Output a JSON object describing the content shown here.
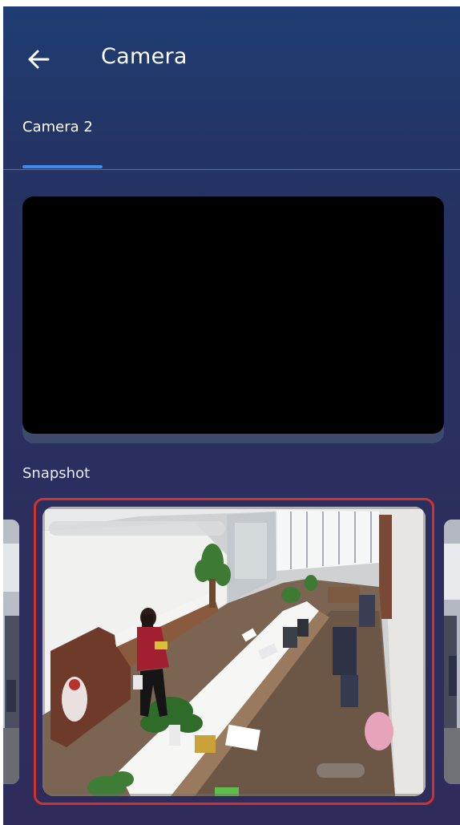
{
  "header": {
    "title": "Camera",
    "back_icon": "arrow-left-icon"
  },
  "tabs": [
    {
      "label": "Camera 2",
      "selected": true
    }
  ],
  "video": {
    "state": "blank"
  },
  "snapshot": {
    "section_label": "Snapshot",
    "selected_index": 1,
    "items": [
      {
        "description": "partial snapshot"
      },
      {
        "description": "office camera snapshot"
      },
      {
        "description": "partial snapshot"
      }
    ]
  },
  "colors": {
    "background_top": "#1f3d73",
    "background_bottom": "#2f2c5b",
    "tab_indicator": "#3d8bea",
    "selected_border": "#d2322e",
    "video_background": "#000000"
  }
}
